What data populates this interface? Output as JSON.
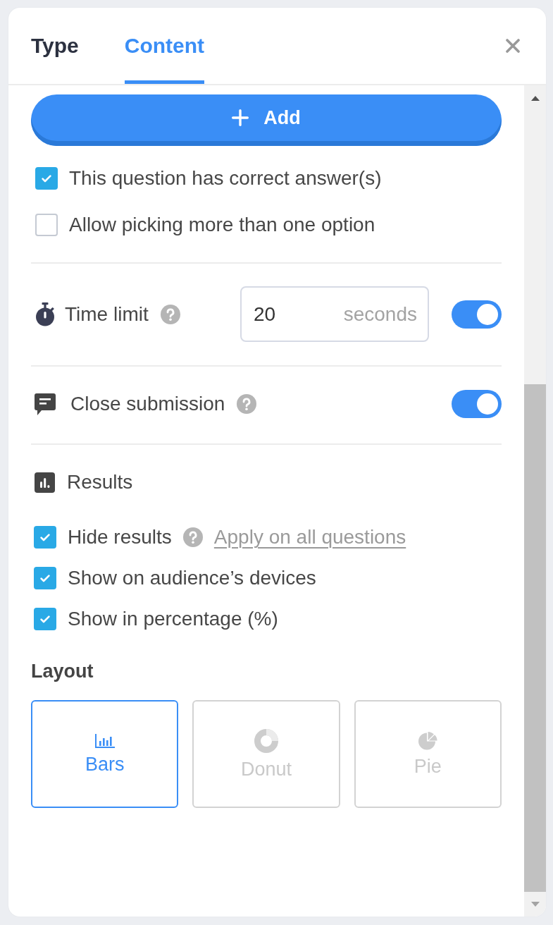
{
  "tabs": [
    {
      "label": "Type",
      "selected": false
    },
    {
      "label": "Content",
      "selected": true
    }
  ],
  "add_button": {
    "label": "Add"
  },
  "answer_options": [
    {
      "label": "This question has correct answer(s)",
      "checked": true
    },
    {
      "label": "Allow picking more than one option",
      "checked": false
    }
  ],
  "time_limit": {
    "label": "Time limit",
    "value": "20",
    "unit": "seconds",
    "on": true
  },
  "close_submission": {
    "label": "Close submission",
    "on": true
  },
  "results": {
    "title": "Results",
    "options": [
      {
        "label": "Hide results",
        "checked": true,
        "help": true,
        "link": "Apply on all questions"
      },
      {
        "label": "Show on audience’s devices",
        "checked": true,
        "help": false
      },
      {
        "label": "Show in percentage (%)",
        "checked": true,
        "help": false
      }
    ]
  },
  "layout": {
    "title": "Layout",
    "options": [
      {
        "kind": "bars",
        "label": "Bars",
        "selected": true
      },
      {
        "kind": "donut",
        "label": "Donut",
        "selected": false
      },
      {
        "kind": "pie",
        "label": "Pie",
        "selected": false
      }
    ]
  }
}
